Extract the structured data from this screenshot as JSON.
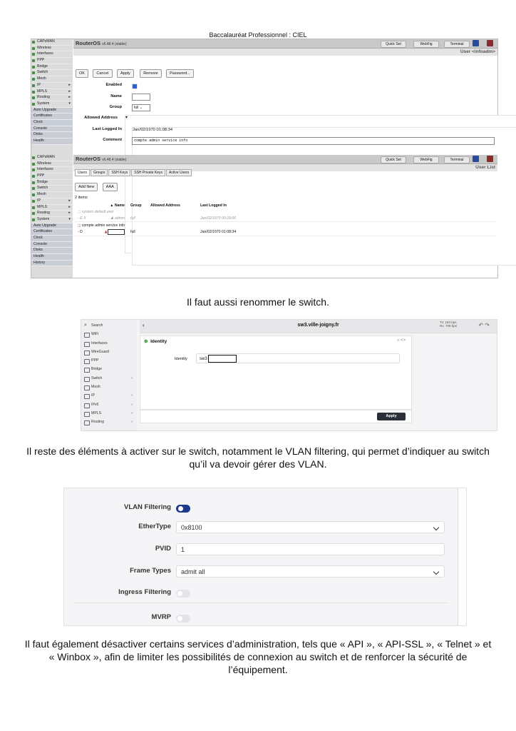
{
  "header": "Baccalauréat Professionnel : CIEL",
  "ros": {
    "sidebar": [
      "CAPsMAN",
      "Wireless",
      "Interfaces",
      "PPP",
      "Bridge",
      "Switch",
      "Mesh",
      "IP",
      "MPLS",
      "Routing",
      "System"
    ],
    "sidebar_sub": [
      "Auto Upgrade",
      "Certificates",
      "Clock",
      "Console",
      "Disks",
      "Health",
      "History"
    ],
    "title": "RouterOS",
    "version": "v6.48.4 (stable)",
    "tb_quickset": "Quick Set",
    "tb_webfig": "WebFig",
    "tb_terminal": "Terminal",
    "user_title": "User <infoadm>",
    "buttons": [
      "OK",
      "Cancel",
      "Apply",
      "Remove",
      "Password..."
    ],
    "f_enabled": "Enabled",
    "f_name": "Name",
    "f_group": "Group",
    "f_group_val": "full",
    "f_allowed": "Allowed Address",
    "f_last": "Last Logged In",
    "f_last_val": "Jan/02/1970 01:08:34",
    "f_comment": "Comment",
    "f_comment_val": "compte admin service info",
    "userlist_title": "User List",
    "tabs": [
      "Users",
      "Groups",
      "SSH Keys",
      "SSH Private Keys",
      "Active Users"
    ],
    "list_buttons": [
      "Add New",
      "AAA"
    ],
    "items_count": "2 items",
    "cols": [
      "▲ Name",
      "Group",
      "Allowed Address",
      "Last Logged In"
    ],
    "row_comment1": ";;; system default user",
    "row1": {
      "flag": "- E",
      "x": "X",
      "name": "admin",
      "group": "full",
      "last": "Jan/02/1970 00:29:00"
    },
    "row_comment2": ";;; compte admin service info",
    "row2": {
      "flag": "- D",
      "group": "full",
      "last": "Jan/02/1970 01:08:34"
    }
  },
  "para1": "Il faut aussi renommer le switch.",
  "idn": {
    "nav": [
      "Search",
      "WiFi",
      "Interfaces",
      "WireGuard",
      "PPP",
      "Bridge",
      "Switch",
      "Mesh",
      "IP",
      "IPv6",
      "MPLS",
      "Routing"
    ],
    "host": "sw3.ville-joigny.fr",
    "tx": "Tx: 184 bps",
    "rx": "Rx: 708 bps",
    "section": "Identity",
    "label": "Identity",
    "value": "sw3",
    "apply": "Apply"
  },
  "para2": "Il reste des éléments à activer sur le switch, notamment le VLAN filtering, qui permet d’indiquer au switch qu’il va devoir gérer des VLAN.",
  "vlan": {
    "filtering": "VLAN Filtering",
    "ethertype": "EtherType",
    "ethertype_val": "0x8100",
    "pvid": "PVID",
    "pvid_val": "1",
    "frametypes": "Frame Types",
    "frametypes_val": "admit all",
    "ingress": "Ingress Filtering",
    "mvrp": "MVRP"
  },
  "para3": "Il faut également désactiver certains services d’administration, tels que « API », « API-SSL », « Telnet » et « Winbox », afin de limiter les possibilités de connexion au switch et de renforcer la sécurité de l’équipement.",
  "colors": {
    "toggle_on": "#1f3a8a",
    "toggle_off": "#e2e4ea",
    "apply_btn": "#2a2f38"
  }
}
